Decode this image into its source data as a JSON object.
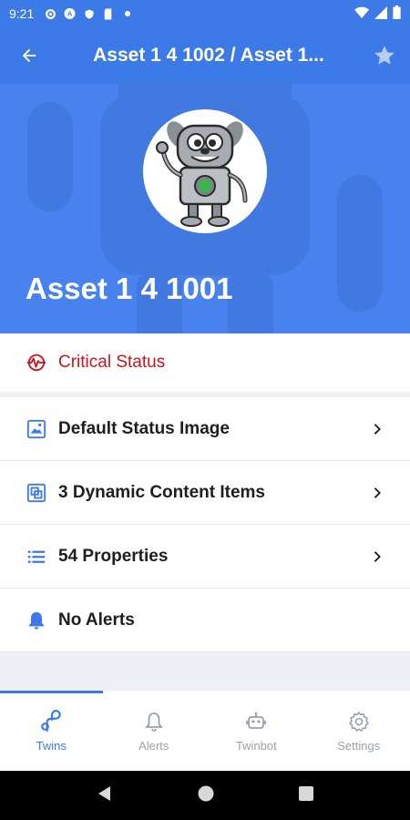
{
  "status_bar": {
    "time": "9:21",
    "icons": [
      "gear-icon",
      "a-icon",
      "shield-icon",
      "sd-card-icon",
      "dot-icon"
    ],
    "right_icons": [
      "wifi-icon",
      "signal-icon",
      "battery-icon"
    ]
  },
  "app_bar": {
    "title": "Asset 1 4 1002 / Asset 1...",
    "back_icon": "arrow-left-icon",
    "star_icon": "star-icon"
  },
  "hero": {
    "name": "Asset 1 4 1001",
    "avatar": "robot-avatar"
  },
  "list": {
    "critical_label": "Critical Status",
    "items": [
      {
        "label": "Default Status Image",
        "icon": "image-icon"
      },
      {
        "label": "3 Dynamic Content Items",
        "icon": "layers-icon"
      },
      {
        "label": "54 Properties",
        "icon": "list-icon"
      },
      {
        "label": "No Alerts",
        "icon": "bell-icon"
      }
    ]
  },
  "bottom_nav": {
    "items": [
      {
        "label": "Twins",
        "icon": "twins-icon",
        "active": true
      },
      {
        "label": "Alerts",
        "icon": "bell-outline-icon",
        "active": false
      },
      {
        "label": "Twinbot",
        "icon": "robot-icon",
        "active": false
      },
      {
        "label": "Settings",
        "icon": "gear-icon",
        "active": false
      }
    ]
  },
  "colors": {
    "primary": "#3c7ae8",
    "critical": "#d0121b",
    "inactive": "#9aa1ad"
  }
}
